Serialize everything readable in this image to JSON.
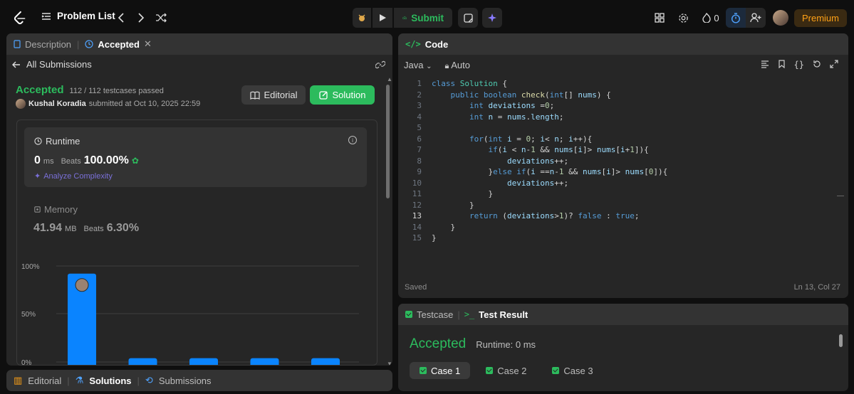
{
  "topbar": {
    "problem_list": "Problem List",
    "submit": "Submit",
    "streak": "0",
    "premium": "Premium"
  },
  "left_panel": {
    "tabs": [
      "Description",
      "Accepted"
    ],
    "back_label": "All Submissions",
    "status": "Accepted",
    "testcases": "112 / 112 testcases passed",
    "author": "Kushal Koradia",
    "submitted_at": "submitted at Oct 10, 2025 22:59",
    "editorial_btn": "Editorial",
    "solution_btn": "Solution",
    "runtime": {
      "label": "Runtime",
      "value": "0",
      "unit": "ms",
      "beats_label": "Beats",
      "beats_value": "100.00%",
      "analyze": "Analyze Complexity"
    },
    "memory": {
      "label": "Memory",
      "value": "41.94",
      "unit": "MB",
      "beats_label": "Beats",
      "beats_value": "6.30%"
    },
    "chart_data": {
      "type": "bar",
      "y_ticks": [
        "100%",
        "50%",
        "0%"
      ],
      "values": [
        92,
        4,
        4,
        4,
        4
      ],
      "ylim": [
        0,
        100
      ]
    }
  },
  "bottom_left_tabs": [
    "Editorial",
    "Solutions",
    "Submissions"
  ],
  "code_panel": {
    "title": "Code",
    "language": "Java",
    "mode": "Auto",
    "saved": "Saved",
    "cursor": "Ln 13, Col 27",
    "lines": [
      "class Solution {",
      "    public boolean check(int[] nums) {",
      "        int deviations =0;",
      "        int n = nums.length;",
      "",
      "        for(int i = 0; i< n; i++){",
      "            if(i < n-1 && nums[i]> nums[i+1]){",
      "                deviations++;",
      "            }else if(i ==n-1 && nums[i]> nums[0]){",
      "                deviations++;",
      "            }",
      "        }",
      "        return (deviations>1)? false : true;",
      "    }",
      "}"
    ]
  },
  "test_panel": {
    "tabs": [
      "Testcase",
      "Test Result"
    ],
    "status": "Accepted",
    "runtime": "Runtime: 0 ms",
    "cases": [
      "Case 1",
      "Case 2",
      "Case 3"
    ]
  },
  "colors": {
    "accent_green": "#2cbb5d",
    "premium_orange": "#ffa116",
    "bar_blue": "#0a84ff",
    "analyze_purple": "#7a70d8"
  }
}
